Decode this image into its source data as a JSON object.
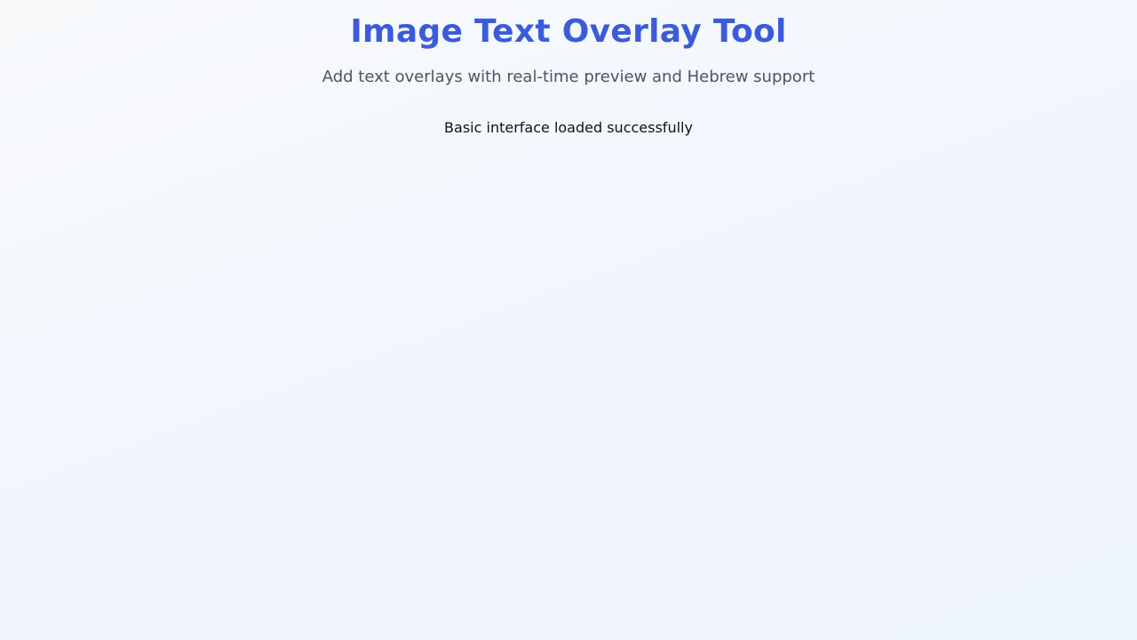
{
  "header": {
    "title": "Image Text Overlay Tool",
    "subtitle": "Add text overlays with real-time preview and Hebrew support"
  },
  "status": {
    "message": "Basic interface loaded successfully"
  },
  "colors": {
    "title": "#3b5bdb",
    "subtitle": "#4b5563",
    "background_start": "#f8fafc",
    "background_end": "#eef4fe"
  }
}
